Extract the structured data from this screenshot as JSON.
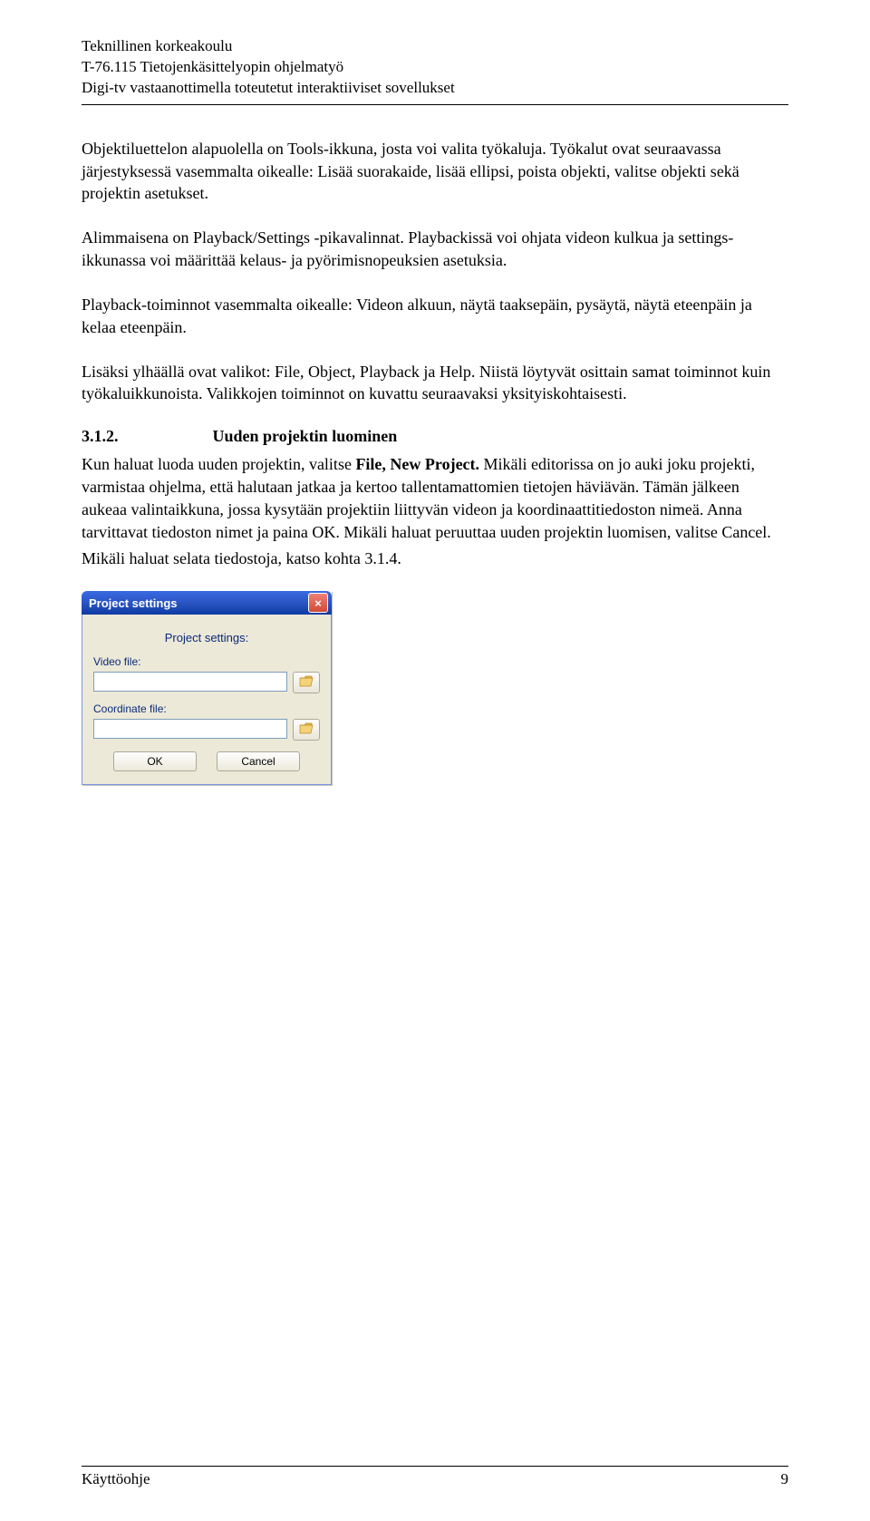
{
  "header": {
    "line1": "Teknillinen korkeakoulu",
    "line2": "T-76.115 Tietojenkäsittelyopin ohjelmatyö",
    "line3": "Digi-tv vastaanottimella toteutetut interaktiiviset sovellukset"
  },
  "paragraphs": {
    "p1": "Objektiluettelon alapuolella on Tools-ikkuna, josta voi valita työkaluja. Työkalut ovat seuraavassa järjestyksessä vasemmalta oikealle: Lisää suorakaide, lisää ellipsi, poista objekti, valitse objekti sekä projektin asetukset.",
    "p2": "Alimmaisena on Playback/Settings -pikavalinnat. Playbackissä voi ohjata videon kulkua ja settings-ikkunassa voi määrittää kelaus- ja pyörimisnopeuksien asetuksia.",
    "p3": "Playback-toiminnot vasemmalta oikealle: Videon alkuun, näytä taaksepäin, pysäytä, näytä eteenpäin ja kelaa eteenpäin.",
    "p4": "Lisäksi ylhäällä ovat valikot: File, Object, Playback ja Help. Niistä löytyvät osittain samat toiminnot kuin työkaluikkunoista. Valikkojen toiminnot on kuvattu seuraavaksi yksityiskohtaisesti."
  },
  "section": {
    "number": "3.1.2.",
    "title": "Uuden projektin luominen",
    "body_before_bold": "Kun haluat luoda uuden projektin, valitse ",
    "bold": "File, New Project.",
    "body_after_bold": " Mikäli editorissa on jo auki joku projekti, varmistaa ohjelma, että halutaan jatkaa ja kertoo tallentamattomien tietojen häviävän. Tämän jälkeen aukeaa valintaikkuna, jossa kysytään projektiin liittyvän videon ja koordinaattitiedoston nimeä. Anna tarvittavat tiedoston nimet ja paina OK. Mikäli haluat peruuttaa uuden projektin luomisen, valitse Cancel.",
    "body_line2": "Mikäli haluat selata tiedostoja, katso kohta 3.1.4."
  },
  "dialog": {
    "title": "Project settings",
    "heading": "Project settings:",
    "video_label": "Video file:",
    "coord_label": "Coordinate file:",
    "video_value": "",
    "coord_value": "",
    "ok_label": "OK",
    "cancel_label": "Cancel",
    "close_icon": "×"
  },
  "footer": {
    "left": "Käyttöohje",
    "right": "9"
  }
}
